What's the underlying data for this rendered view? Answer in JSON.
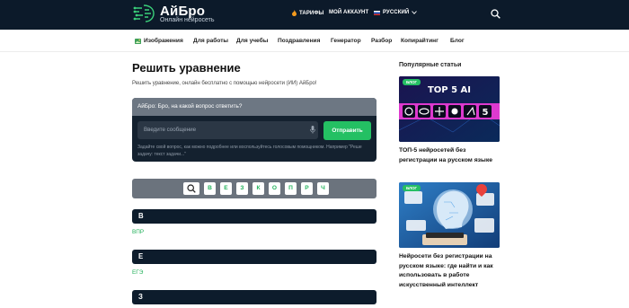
{
  "header": {
    "logo_title": "АйБро",
    "logo_subtitle": "Онлайн нейросеть",
    "nav_tariffs": "ТАРИФЫ",
    "nav_account": "МОЙ АККАУНТ",
    "nav_language": "РУССКИЙ",
    "colors": {
      "background": "#0c1a2a",
      "accent": "#24c063"
    }
  },
  "subnav": {
    "items": [
      "Изображения",
      "Для работы",
      "Для учебы",
      "Поздравления",
      "Генератор",
      "Разбор",
      "Копирайтинг",
      "Блог"
    ]
  },
  "main": {
    "title": "Решить уравнение",
    "description": "Решить уравнение, онлайн бесплатно с помощью нейросети (ИИ) АйБро!",
    "chat": {
      "prompt": "АйБро: Бро, на какой вопрос ответить?",
      "input_placeholder": "Введите сообщение",
      "send_label": "Отправить",
      "hint": "Задайте свой вопрос, как можно подробнее или воспользуйтесь голосовым помощником. Например \"Реше задачу: текст задачи...\""
    },
    "alphabet": [
      "В",
      "Е",
      "З",
      "К",
      "О",
      "П",
      "Р",
      "Ч"
    ],
    "sections": [
      {
        "letter": "В",
        "link": "ВПР"
      },
      {
        "letter": "Е",
        "link": "ЕГЭ"
      },
      {
        "letter": "З",
        "link": ""
      }
    ]
  },
  "sidebar": {
    "title": "Популярные статьи",
    "articles": [
      {
        "tag": "БЛОГ",
        "image_text": "TOP 5 AI",
        "title": "ТОП-5 нейросетей без регистрации на русском языке"
      },
      {
        "tag": "БЛОГ",
        "title": "Нейросети без регистрации на русском языке: где найти и как использовать в работе искусственный интеллект"
      }
    ]
  }
}
